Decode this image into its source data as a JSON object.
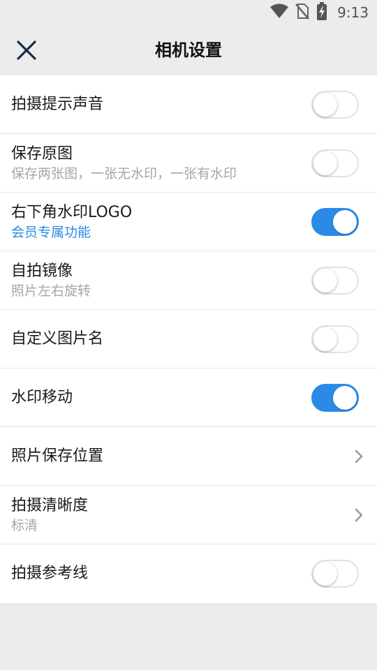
{
  "status_bar": {
    "time": "9:13",
    "icons": [
      "wifi-icon",
      "no-sim-icon",
      "battery-charging-icon"
    ]
  },
  "header": {
    "title": "相机设置",
    "close_icon": "close-icon"
  },
  "colors": {
    "accent": "#2a8be6",
    "background": "#ececec",
    "card": "#ffffff",
    "subtext": "#a6a6a6"
  },
  "settings": [
    {
      "label": "拍摄提示声音",
      "subtitle": "",
      "control": "toggle",
      "on": false
    },
    {
      "label": "保存原图",
      "subtitle": "保存两张图，一张无水印，一张有水印",
      "control": "toggle",
      "on": false
    },
    {
      "label": "右下角水印LOGO",
      "subtitle": "会员专属功能",
      "control": "toggle",
      "on": true
    },
    {
      "label": "自拍镜像",
      "subtitle": "照片左右旋转",
      "control": "toggle",
      "on": false
    },
    {
      "label": "自定义图片名",
      "subtitle": "",
      "control": "toggle",
      "on": false
    },
    {
      "label": "水印移动",
      "subtitle": "",
      "control": "toggle",
      "on": true
    },
    {
      "label": "照片保存位置",
      "subtitle": "",
      "control": "chevron",
      "on": null
    },
    {
      "label": "拍摄清晰度",
      "subtitle": "标清",
      "control": "chevron",
      "on": null
    },
    {
      "label": "拍摄参考线",
      "subtitle": "",
      "control": "toggle",
      "on": false
    }
  ]
}
